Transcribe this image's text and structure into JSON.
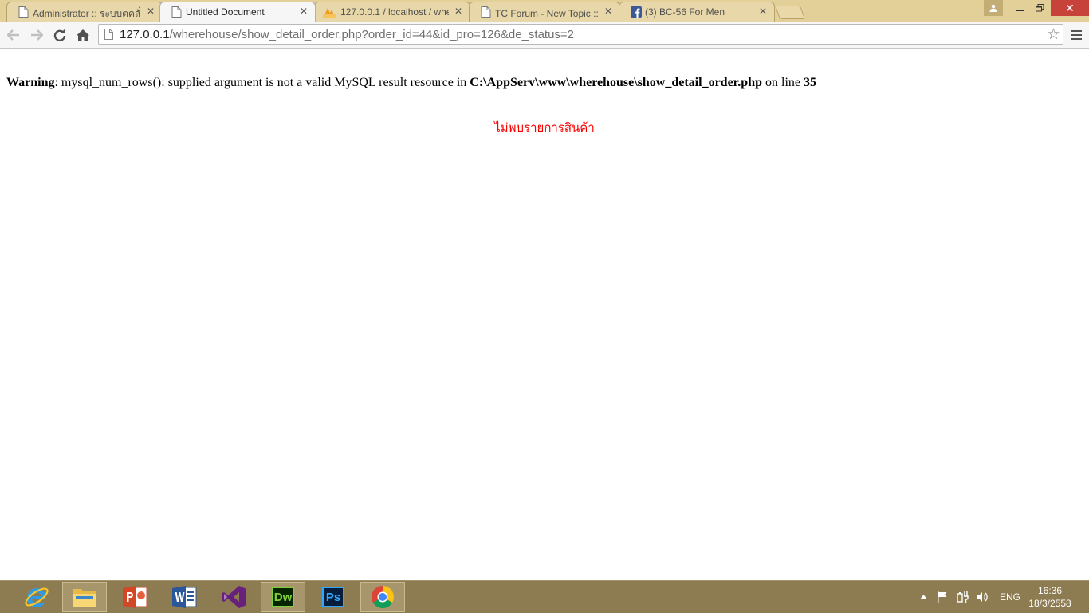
{
  "browser": {
    "tabs": [
      {
        "title": "Administrator :: ระบบตคสั่งสิน",
        "favicon": "page-icon",
        "active": false
      },
      {
        "title": "Untitled Document",
        "favicon": "page-icon",
        "active": true
      },
      {
        "title": "127.0.0.1 / localhost / whe",
        "favicon": "phpmyadmin-icon",
        "active": false
      },
      {
        "title": "TC Forum - New Topic :: ส",
        "favicon": "page-icon",
        "active": false
      },
      {
        "title": "(3) BC-56 For Men",
        "favicon": "facebook-icon",
        "active": false
      }
    ],
    "address": {
      "host": "127.0.0.1",
      "path": "/wherehouse/show_detail_order.php?order_id=44&id_pro=126&de_status=2"
    }
  },
  "page": {
    "warning": {
      "label": "Warning",
      "message": ": mysql_num_rows(): supplied argument is not a valid MySQL result resource in ",
      "file": "C:\\AppServ\\www\\wherehouse\\show_detail_order.php",
      "on_line": " on line ",
      "line": "35"
    },
    "not_found": "ไม่พบรายการสินค้า",
    "not_found_color": "#ff0000"
  },
  "taskbar": {
    "apps": [
      "internet-explorer-icon",
      "file-explorer-icon",
      "powerpoint-icon",
      "word-icon",
      "visual-studio-icon",
      "dreamweaver-icon",
      "photoshop-icon",
      "chrome-icon"
    ],
    "dreamweaver_label": "Dw",
    "photoshop_label": "Ps",
    "language": "ENG",
    "time": "16:36",
    "date": "18/3/2558"
  },
  "colors": {
    "tabstrip": "#e3cf98",
    "taskbar": "#8d7b52",
    "close_button": "#c7423a"
  }
}
